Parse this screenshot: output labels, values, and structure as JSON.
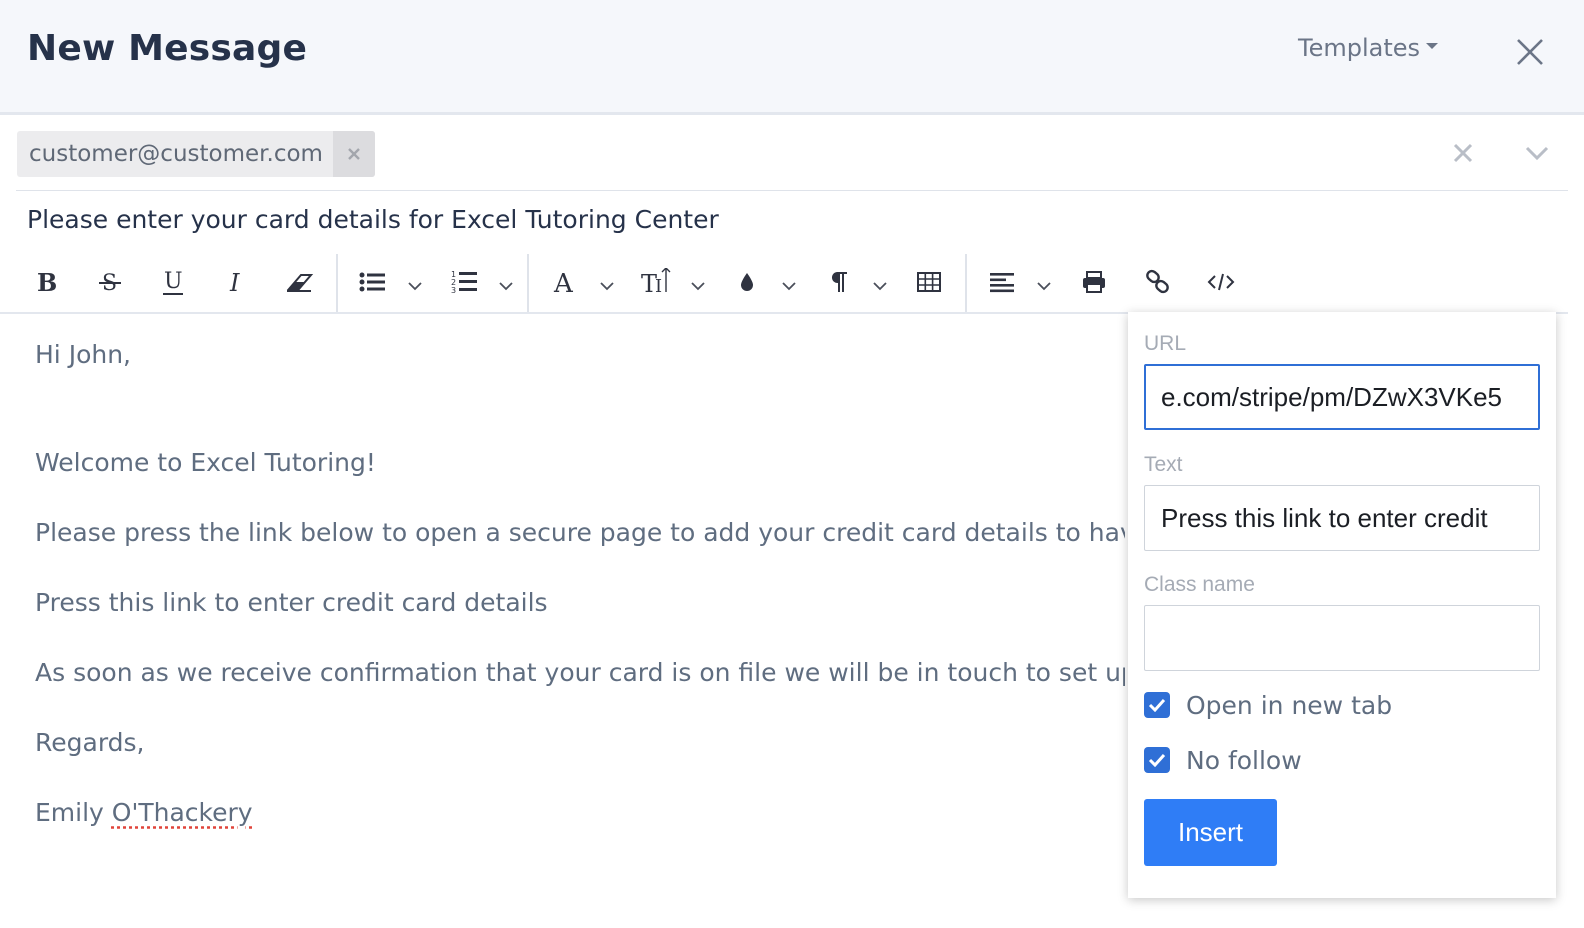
{
  "header": {
    "title": "New Message",
    "templates_label": "Templates"
  },
  "recipients": {
    "chips": [
      {
        "email": "customer@customer.com"
      }
    ]
  },
  "subject": "Please enter your card details for Excel Tutoring Center",
  "toolbar": {
    "buttons": [
      "bold-icon",
      "strikethrough-icon",
      "underline-icon",
      "italic-icon",
      "eraser-icon",
      "bulleted-list-icon",
      "numbered-list-icon",
      "font-icon",
      "font-size-icon",
      "color-drop-icon",
      "paragraph-icon",
      "table-icon",
      "align-left-icon",
      "print-icon",
      "link-icon",
      "code-view-icon"
    ]
  },
  "body": {
    "lines": [
      "Hi John,",
      "Welcome to Excel Tutoring!",
      "Please press the link below to open a secure page to add your credit card details to have on",
      "Press this link to enter credit card details",
      "As soon as we receive confirmation that your card is on file we will be in touch to set up you",
      "Regards,",
      "Emily O'Thackery"
    ],
    "signature_first": "Emily ",
    "signature_last": "O'Thackery"
  },
  "link_popup": {
    "url_label": "URL",
    "url_value": "e.com/stripe/pm/DZwX3VKe5",
    "text_label": "Text",
    "text_value": "Press this link to enter credit",
    "class_label": "Class name",
    "class_value": "",
    "open_new_tab_label": "Open in new tab",
    "open_new_tab_checked": true,
    "no_follow_label": "No follow",
    "no_follow_checked": true,
    "insert_label": "Insert"
  },
  "colors": {
    "accent": "#2f7df6",
    "focus_border": "#2f6fd6",
    "header_bg": "#f5f7fb"
  }
}
